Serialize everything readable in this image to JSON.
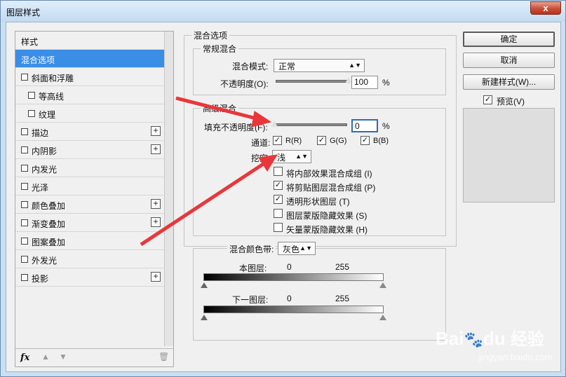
{
  "window": {
    "title": "图层样式",
    "close_glyph": "x"
  },
  "styles_list": {
    "header": "样式",
    "items": [
      {
        "label": "混合选项",
        "selected": true,
        "checkbox": false,
        "plus": false
      },
      {
        "label": "斜面和浮雕",
        "checkbox": true,
        "plus": false
      },
      {
        "label": "等高线",
        "checkbox": true,
        "indent": true,
        "plus": false
      },
      {
        "label": "纹理",
        "checkbox": true,
        "indent": true,
        "plus": false
      },
      {
        "label": "描边",
        "checkbox": true,
        "plus": true
      },
      {
        "label": "内阴影",
        "checkbox": true,
        "plus": true
      },
      {
        "label": "内发光",
        "checkbox": true,
        "plus": false
      },
      {
        "label": "光泽",
        "checkbox": true,
        "plus": false
      },
      {
        "label": "颜色叠加",
        "checkbox": true,
        "plus": true
      },
      {
        "label": "渐变叠加",
        "checkbox": true,
        "plus": true
      },
      {
        "label": "图案叠加",
        "checkbox": true,
        "plus": false
      },
      {
        "label": "外发光",
        "checkbox": true,
        "plus": false
      },
      {
        "label": "投影",
        "checkbox": true,
        "plus": true
      }
    ],
    "plus_glyph": "+",
    "footer": {
      "fx_label": "fx",
      "up_icon": "▲",
      "down_icon": "▼",
      "trash_icon": "🗑"
    }
  },
  "blending": {
    "section_title": "混合选项",
    "general": {
      "title": "常规混合",
      "mode_label": "混合模式:",
      "mode_value": "正常",
      "opacity_label": "不透明度(O):",
      "opacity_value": "100",
      "opacity_unit": "%",
      "opacity_level": 1.0
    },
    "advanced": {
      "title": "高级混合",
      "fill_label": "填充不透明度(F):",
      "fill_value": "0",
      "fill_unit": "%",
      "fill_level": 0.0,
      "channels_label": "通道:",
      "channels": [
        {
          "label": "R(R)",
          "checked": true
        },
        {
          "label": "G(G)",
          "checked": true
        },
        {
          "label": "B(B)",
          "checked": true
        }
      ],
      "knockout_label": "挖空:",
      "knockout_value": "浅",
      "options": [
        {
          "label": "将内部效果混合成组 (I)",
          "checked": false
        },
        {
          "label": "将剪贴图层混合成组 (P)",
          "checked": true
        },
        {
          "label": "透明形状图层 (T)",
          "checked": true
        },
        {
          "label": "图层蒙版隐藏效果 (S)",
          "checked": false
        },
        {
          "label": "矢量蒙版隐藏效果 (H)",
          "checked": false
        }
      ]
    },
    "blend_if": {
      "label": "混合颜色带:",
      "value": "灰色",
      "this_layer_label": "本图层:",
      "this_layer_min": "0",
      "this_layer_max": "255",
      "below_layer_label": "下一图层:",
      "below_layer_min": "0",
      "below_layer_max": "255"
    }
  },
  "buttons": {
    "ok": "确定",
    "cancel": "取消",
    "new_style": "新建样式(W)...",
    "preview_label": "预览(V)",
    "preview_checked": true,
    "check_glyph": "✓"
  },
  "watermark": {
    "brand": "Bai",
    "brand2": "du",
    "product": "经验",
    "url": "jingyan.baidu.com"
  },
  "colors": {
    "selection": "#3a8ee6",
    "arrow": "#e8373a",
    "focus": "#2d6cb8"
  }
}
